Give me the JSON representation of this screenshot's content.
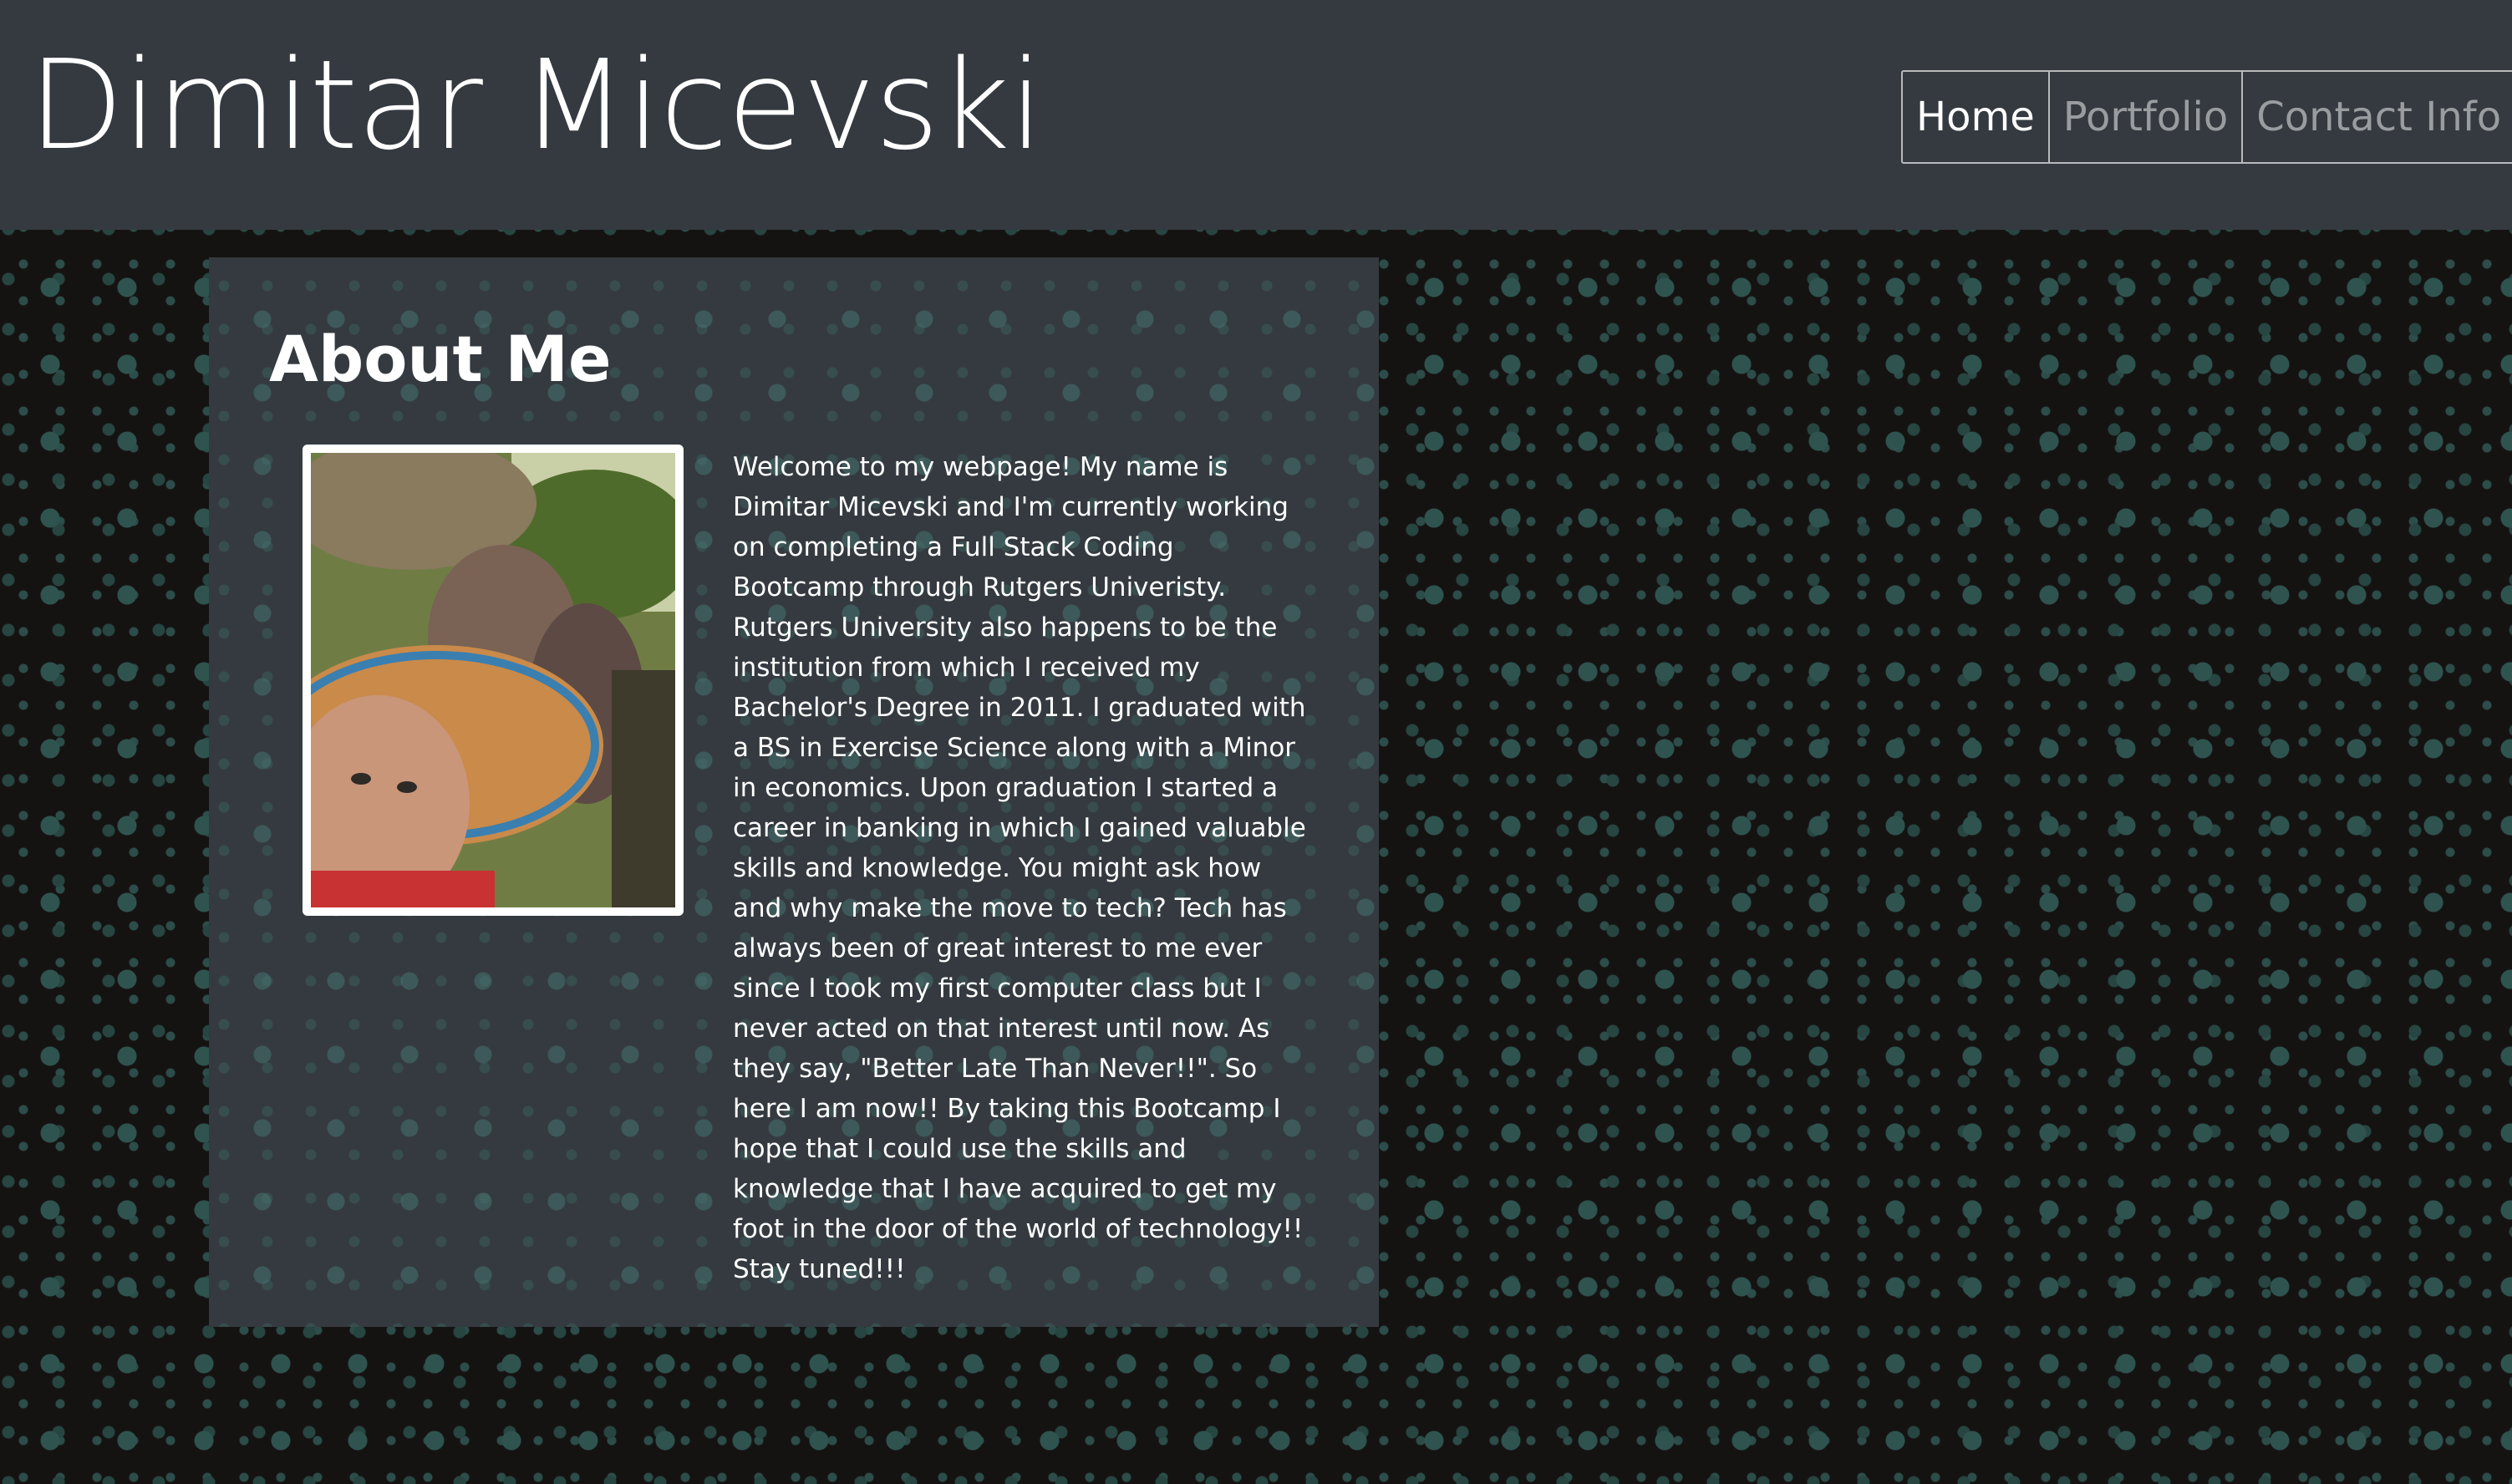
{
  "header": {
    "brand": "Dimitar Micevski",
    "nav": [
      {
        "label": "Home",
        "active": true
      },
      {
        "label": "Portfolio",
        "active": false
      },
      {
        "label": "Contact Info",
        "active": false
      }
    ]
  },
  "about": {
    "title": "About Me",
    "photo_icon": "profile-photo",
    "bio": "Welcome to my webpage! My name is Dimitar Micevski and I'm currently working on completing a Full Stack Coding Bootcamp through Rutgers Univeristy. Rutgers University also happens to be the institution from which I received my Bachelor's Degree in 2011. I graduated with a BS in Exercise Science along with a Minor in economics. Upon graduation I started a career in banking in which I gained valuable skills and knowledge. You might ask how and why make the move to tech? Tech has always been of great interest to me ever since I took my first computer class but I never acted on that interest until now. As they say, \"Better Late Than Never!!\". So here I am now!! By taking this Bootcamp I hope that I could use the skills and knowledge that I have acquired to get my foot in the door of the world of technology!! Stay tuned!!!"
  },
  "colors": {
    "navbar": "#343a40",
    "page_background": "#151312",
    "dot_accent": "#2f5450",
    "text": "#ffffff"
  }
}
